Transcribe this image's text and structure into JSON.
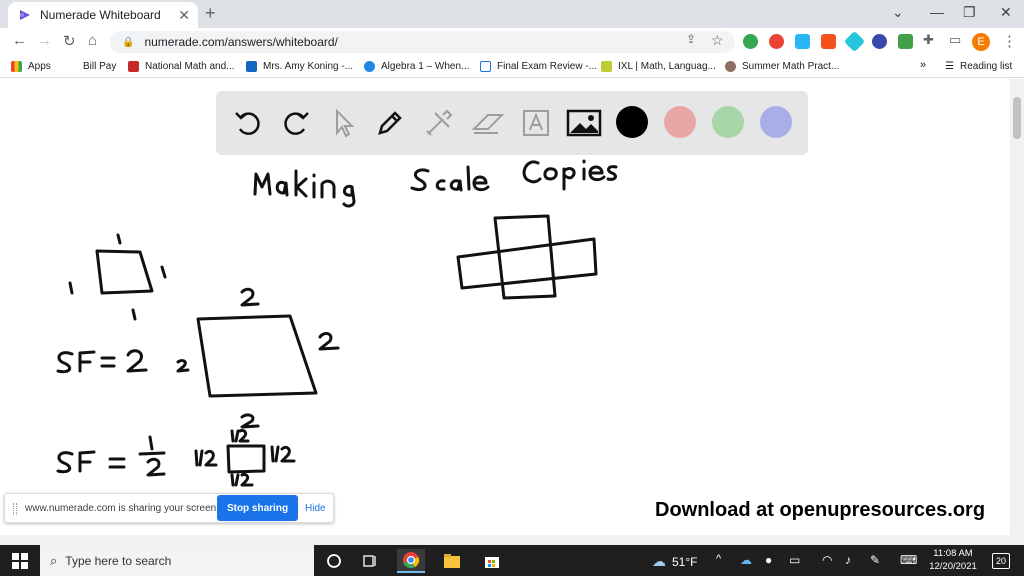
{
  "browser": {
    "tab_title": "Numerade Whiteboard",
    "url": "numerade.com/answers/whiteboard/",
    "bookmarks": [
      {
        "label": "Apps",
        "color": "#ea4335"
      },
      {
        "label": "Bill Pay",
        "color": "#ffffff"
      },
      {
        "label": "National Math and...",
        "color": "#c62828"
      },
      {
        "label": "Mrs. Amy Koning -...",
        "color": "#1565c0"
      },
      {
        "label": "Algebra 1 – When...",
        "color": "#1e88e5"
      },
      {
        "label": "Final Exam Review -...",
        "color": "#1a73e8"
      },
      {
        "label": "IXL | Math, Languag...",
        "color": "#c0ca33"
      },
      {
        "label": "Summer Math Pract...",
        "color": "#8d6e63"
      }
    ],
    "bookmarks_overflow": "»",
    "reading_list": "Reading list",
    "profile_initial": "E"
  },
  "whiteboard": {
    "tool_names": [
      "undo",
      "redo",
      "select",
      "pen",
      "tools",
      "eraser",
      "text",
      "image"
    ],
    "colors": [
      "#000000",
      "#e8a7a5",
      "#a8d5a8",
      "#a8aee8"
    ],
    "handwritten": {
      "title": "Making Scale Copies",
      "sf2": "SF = 2",
      "sf_half": "SF = 1/2",
      "labels_small_square": [
        "1",
        "1",
        "1",
        "1"
      ],
      "labels_big_square": [
        "2",
        "2",
        "2",
        "2"
      ],
      "labels_half_square": [
        "1/2",
        "1/2",
        "1/2",
        "1/2"
      ]
    }
  },
  "watermark": "Download at openupresources.org",
  "share_bar": {
    "message": "www.numerade.com is sharing your screen.",
    "stop_label": "Stop sharing",
    "hide_label": "Hide"
  },
  "taskbar": {
    "search_placeholder": "Type here to search",
    "weather": "51°F",
    "time": "11:08 AM",
    "date": "12/20/2021",
    "notification_count": "20"
  }
}
